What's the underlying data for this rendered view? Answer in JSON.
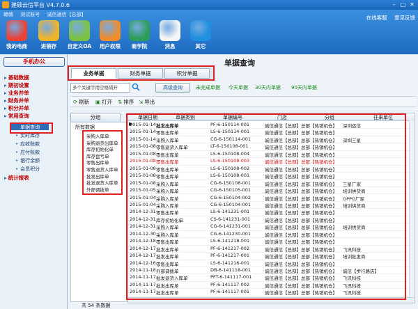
{
  "window": {
    "title": "建硕云信平台  V4.7.0.6",
    "controls": [
      "–",
      "□",
      "✕"
    ]
  },
  "ribbon": {
    "user_info": [
      "赣赣",
      "测试账号",
      "诚信通信【总部】"
    ],
    "right_links": [
      "在线客服",
      "意见反馈"
    ],
    "buttons": [
      {
        "label": "我的电商",
        "icon": "home-icon",
        "color": "#e8443a"
      },
      {
        "label": "进销存",
        "icon": "chart-icon",
        "color": "#f0b429"
      },
      {
        "label": "自定义OA",
        "icon": "pencil-icon",
        "color": "#7cc242"
      },
      {
        "label": "用户权限",
        "icon": "users-icon",
        "color": "#f08c2a"
      },
      {
        "label": "商学院",
        "icon": "students-icon",
        "color": "#2f9d5a"
      },
      {
        "label": "消息",
        "icon": "cloud-icon",
        "color": "#f5f5f5"
      },
      {
        "label": "其它",
        "icon": "download-icon",
        "color": "#1f8fe0"
      }
    ]
  },
  "leftnav": {
    "mobile_office": "手机办公",
    "sections": [
      "基础数据",
      "期初设置",
      "业务并单",
      "财务并单",
      "积分并单",
      "常用查询"
    ],
    "subitems": [
      "单据查询",
      "实时库存",
      "应收账款",
      "应付账款",
      "银行余额",
      "会员积分"
    ],
    "last_section": "统计报表"
  },
  "main": {
    "title": "单据查询",
    "tabs": [
      "业务单据",
      "财务单据",
      "积分单据"
    ],
    "search_placeholder": "多个关键字用空格隔开",
    "advanced_query": "高级查询",
    "quick_links": [
      "未完成单据",
      "今天单据",
      "30天内单据",
      "90天内单据"
    ],
    "actions": [
      {
        "icon": "refresh-icon",
        "label": "刷新"
      },
      {
        "icon": "print-icon",
        "label": "打开"
      },
      {
        "icon": "sort-icon",
        "label": "排序"
      },
      {
        "icon": "export-icon",
        "label": "导出"
      }
    ],
    "group_label": "分组",
    "tree_root": "所有数据",
    "tree_items": [
      "采购入库单",
      "采购退货出库单",
      "库存初始化单",
      "库存盘亏单",
      "零售出库单",
      "零售退货入库单",
      "批发出库单",
      "批发退货入库单",
      "外部调拨单"
    ],
    "total": "共 54 条数据"
  },
  "table": {
    "headers": [
      "单据日期",
      "单据类别",
      "单据编号",
      "门店",
      "分组",
      "往来单位"
    ],
    "rows": [
      {
        "date": "2015-01-14",
        "type": "批发出库单",
        "no": "PF-6-150114-001",
        "store": "诚信通信【总部】",
        "group": "总部【热销机仓】",
        "party": "深圳运信",
        "red": false
      },
      {
        "date": "2015-01-14",
        "type": "零售出库单",
        "no": "LS-6-150114-001",
        "store": "诚信通信【总部】",
        "group": "总部【热销机仓】",
        "party": "",
        "red": false
      },
      {
        "date": "2015-01-14",
        "type": "采购入库单",
        "no": "CG-6-150114-001",
        "store": "诚信通信【总部】",
        "group": "总部【热销机仓】",
        "party": "深圳三星",
        "red": false
      },
      {
        "date": "2015-01-08",
        "type": "零售退货入库单",
        "no": "LT-6-150108-001",
        "store": "诚信通信【总部】",
        "group": "总部【热销机仓】",
        "party": "",
        "red": false
      },
      {
        "date": "2015-01-08",
        "type": "零售出库单",
        "no": "LS-6-150108-004",
        "store": "诚信通信【总部】",
        "group": "总部【热销机仓】",
        "party": "",
        "red": false
      },
      {
        "date": "2015-01-08",
        "type": "零售出库单",
        "no": "LS-6-150108-003",
        "store": "诚信通信【总部】",
        "group": "总部【热销机仓】",
        "party": "",
        "red": true
      },
      {
        "date": "2015-01-08",
        "type": "零售出库单",
        "no": "LS-6-150108-002",
        "store": "诚信通信【总部】",
        "group": "总部【热销机仓】",
        "party": "",
        "red": false
      },
      {
        "date": "2015-01-08",
        "type": "零售出库单",
        "no": "LS-6-150108-001",
        "store": "诚信通信【总部】",
        "group": "总部【热销机仓】",
        "party": "",
        "red": false
      },
      {
        "date": "2015-01-08",
        "type": "采购入库单",
        "no": "CG-6-150108-001",
        "store": "诚信通信【总部】",
        "group": "总部【热销机仓】",
        "party": "三星厂家",
        "red": false
      },
      {
        "date": "2015-01-05",
        "type": "采购入库单",
        "no": "CG-6-150105-001",
        "store": "诚信通信【总部】",
        "group": "总部【热销机仓】",
        "party": "培训供货商",
        "red": false
      },
      {
        "date": "2015-01-04",
        "type": "采购入库单",
        "no": "CG-6-150104-002",
        "store": "诚信通信【总部】",
        "group": "总部【热销机仓】",
        "party": "OPPO厂家",
        "red": false
      },
      {
        "date": "2015-01-04",
        "type": "采购入库单",
        "no": "CG-6-150104-001",
        "store": "诚信通信【总部】",
        "group": "总部【热销机仓】",
        "party": "培训供货商",
        "red": false
      },
      {
        "date": "2014-12-31",
        "type": "零售出库单",
        "no": "LS-6-141231-001",
        "store": "诚信通信【总部】",
        "group": "总部【热销机仓】",
        "party": "",
        "red": false
      },
      {
        "date": "2014-12-31",
        "type": "库存初始化单",
        "no": "CS-6-141231-001",
        "store": "诚信通信【总部】",
        "group": "总部【热销机仓】",
        "party": "",
        "red": false
      },
      {
        "date": "2014-12-31",
        "type": "采购入库单",
        "no": "CG-6-141231-001",
        "store": "诚信通信【总部】",
        "group": "总部【热销机仓】",
        "party": "培训供货商",
        "red": false
      },
      {
        "date": "2014-12-30",
        "type": "采购入库单",
        "no": "CG-6-141230-001",
        "store": "诚信通信【总部】",
        "group": "总部【热销机仓】",
        "party": "",
        "red": false
      },
      {
        "date": "2014-12-18",
        "type": "零售出库单",
        "no": "LS-6-141218-001",
        "store": "诚信通信【总部】",
        "group": "总部【热销机仓】",
        "party": "",
        "red": false
      },
      {
        "date": "2014-12-17",
        "type": "批发出库单",
        "no": "PF-6-141217-002",
        "store": "诚信通信【总部】",
        "group": "总部【热销机仓】",
        "party": "飞讯科技",
        "red": false
      },
      {
        "date": "2014-12-17",
        "type": "批发出库单",
        "no": "PF-6-141217-001",
        "store": "诚信通信【总部】",
        "group": "总部【热销机仓】",
        "party": "培训批发商",
        "red": false
      },
      {
        "date": "2014-12-16",
        "type": "零售出库单",
        "no": "LS-6-141216-001",
        "store": "诚信通信【总部】",
        "group": "总部【热销机仓】",
        "party": "",
        "red": false
      },
      {
        "date": "2014-11-18",
        "type": "外部调拨单",
        "no": "DB-6-141118-001",
        "store": "诚信通信【总部】",
        "group": "总部【热销机仓】",
        "party": "诚信【步行路店】",
        "red": false
      },
      {
        "date": "2014-11-17",
        "type": "批发退货入库单",
        "no": "PFT-6-141117-001",
        "store": "诚信通信【总部】",
        "group": "总部【热销机仓】",
        "party": "飞讯科技",
        "red": false
      },
      {
        "date": "2014-11-17",
        "type": "批发出库单",
        "no": "PF-6-141117-002",
        "store": "诚信通信【总部】",
        "group": "总部【热销机仓】",
        "party": "飞讯科技",
        "red": false
      },
      {
        "date": "2014-11-17",
        "type": "批发出库单",
        "no": "PF-6-141117-001",
        "store": "诚信通信【总部】",
        "group": "总部【热销机仓】",
        "party": "飞讯科技",
        "red": false
      }
    ]
  }
}
